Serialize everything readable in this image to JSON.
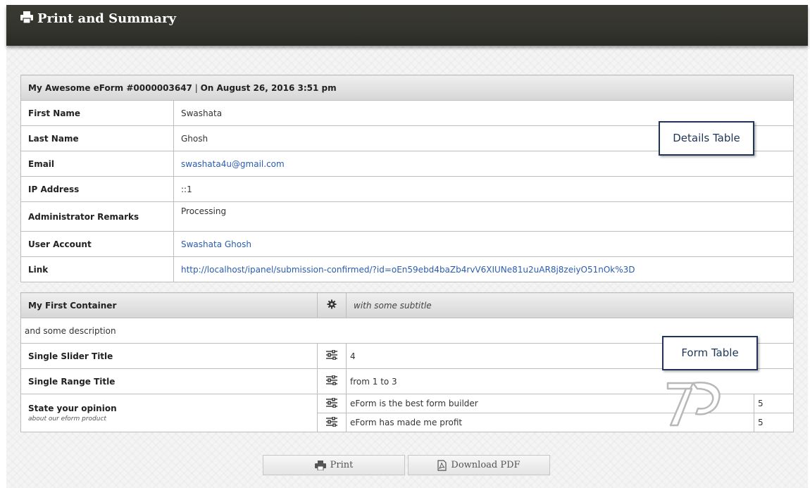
{
  "header": {
    "title": "Print and Summary"
  },
  "details": {
    "heading_form": "My Awesome eForm #0000003647",
    "heading_sep": " | ",
    "heading_date": "On August 26, 2016 3:51 pm",
    "rows": [
      {
        "label": "First Name",
        "value": "Swashata"
      },
      {
        "label": "Last Name",
        "value": "Ghosh"
      },
      {
        "label": "Email",
        "value": "swashata4u@gmail.com"
      },
      {
        "label": "IP Address",
        "value": "::1"
      },
      {
        "label": "Administrator Remarks",
        "value": "Processing"
      },
      {
        "label": "User Account",
        "value": "Swashata Ghosh"
      },
      {
        "label": "Link",
        "value": "http://localhost/ipanel/submission-confirmed/?id=oEn59ebd4baZb4rvV6XIUNe81u2uAR8j8zeiyO51nOk%3D"
      }
    ]
  },
  "container": {
    "title": "My First Container",
    "subtitle": "with some subtitle",
    "description": "and some description",
    "rows": [
      {
        "label": "Single Slider Title",
        "value": "4"
      },
      {
        "label": "Single Range Title",
        "value": "from 1 to 3"
      }
    ],
    "opinion": {
      "label": "State your opinion",
      "sublabel": "about our eform product",
      "items": [
        {
          "text": "eForm is the best form builder",
          "score": "5"
        },
        {
          "text": "eForm has made me profit",
          "score": "5"
        }
      ]
    }
  },
  "callouts": {
    "details": "Details Table",
    "form": "Form Table"
  },
  "buttons": {
    "print": "Print",
    "download": "Download PDF"
  }
}
